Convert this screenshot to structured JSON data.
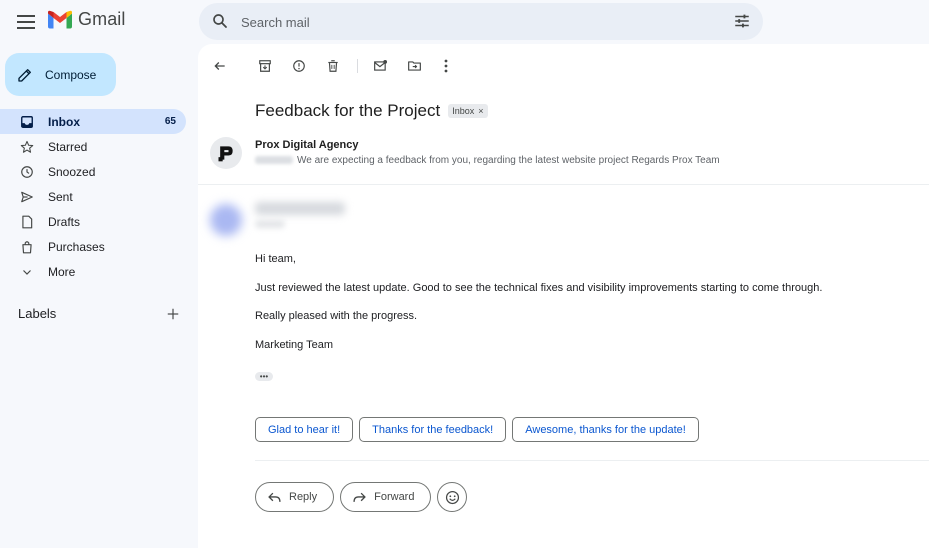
{
  "app": {
    "name": "Gmail"
  },
  "search": {
    "placeholder": "Search mail"
  },
  "compose": {
    "label": "Compose"
  },
  "sidebar": {
    "items": [
      {
        "label": "Inbox",
        "count": "65",
        "icon": "inbox-icon",
        "active": true
      },
      {
        "label": "Starred",
        "icon": "star-icon"
      },
      {
        "label": "Snoozed",
        "icon": "clock-icon"
      },
      {
        "label": "Sent",
        "icon": "send-icon"
      },
      {
        "label": "Drafts",
        "icon": "draft-icon"
      },
      {
        "label": "Purchases",
        "icon": "purchases-icon"
      },
      {
        "label": "More",
        "icon": "chevron-down-icon"
      }
    ],
    "labels_heading": "Labels"
  },
  "email": {
    "subject": "Feedback for the Project",
    "label_chip": "Inbox",
    "thread_sender": "Prox Digital Agency",
    "snippet": "We are expecting a feedback from you, regarding the latest website project Regards Prox Team",
    "body": [
      "Hi team,",
      "Just reviewed the latest update. Good to see the technical fixes and visibility improvements starting to come through.",
      "Really pleased with the progress.",
      "Marketing Team"
    ],
    "smart_replies": [
      "Glad to hear it!",
      "Thanks for the feedback!",
      "Awesome, thanks for the update!"
    ],
    "actions": {
      "reply": "Reply",
      "forward": "Forward"
    }
  },
  "colors": {
    "background": "#f6f8fc",
    "compose": "#c2e7ff",
    "active_nav": "#d3e3fd",
    "search": "#e9eef6",
    "link_blue": "#0b57d0"
  }
}
